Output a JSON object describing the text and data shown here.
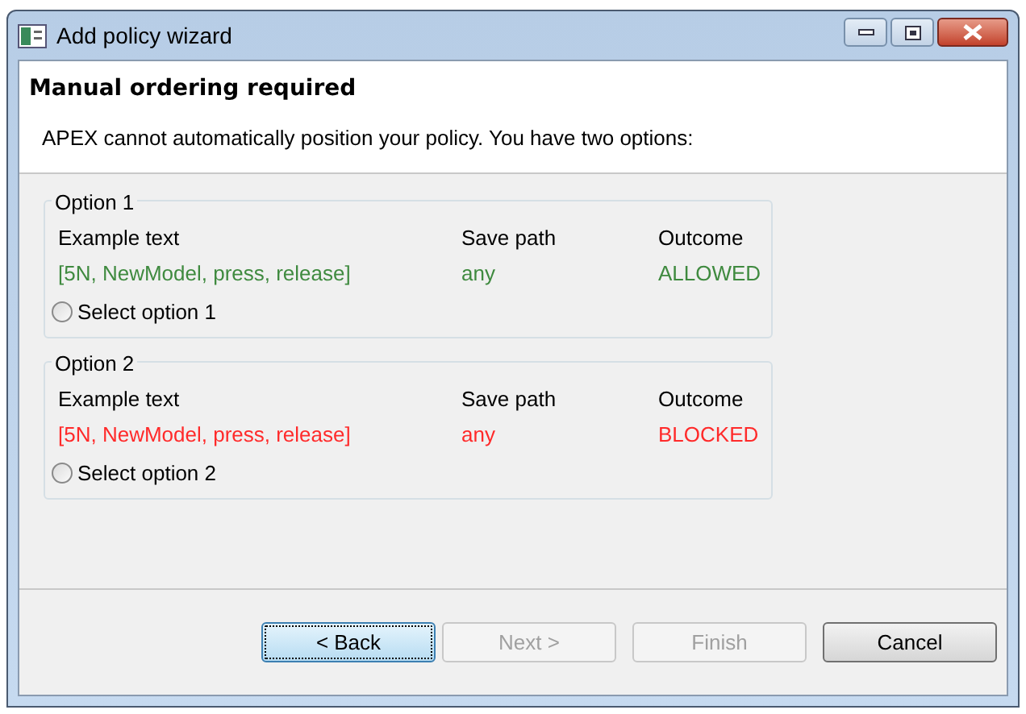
{
  "window": {
    "title": "Add policy wizard"
  },
  "header": {
    "title": "Manual ordering required",
    "message": "APEX cannot automatically position your policy. You have two options:"
  },
  "options": [
    {
      "legend": "Option 1",
      "columns": [
        "Example text",
        "Save path",
        "Outcome"
      ],
      "values": [
        "[5N, NewModel, press, release]",
        "any",
        "ALLOWED"
      ],
      "color": "#3f8a3f",
      "radio_label": "Select option 1",
      "selected": false
    },
    {
      "legend": "Option 2",
      "columns": [
        "Example text",
        "Save path",
        "Outcome"
      ],
      "values": [
        "[5N, NewModel, press, release]",
        "any",
        "BLOCKED"
      ],
      "color": "#ff2a2a",
      "radio_label": "Select option 2",
      "selected": false
    }
  ],
  "buttons": [
    {
      "label": "< Back",
      "disabled": false,
      "focused": true
    },
    {
      "label": "Next >",
      "disabled": true,
      "focused": false
    },
    {
      "label": "Finish",
      "disabled": true,
      "focused": false
    },
    {
      "label": "Cancel",
      "disabled": false,
      "focused": false
    }
  ]
}
